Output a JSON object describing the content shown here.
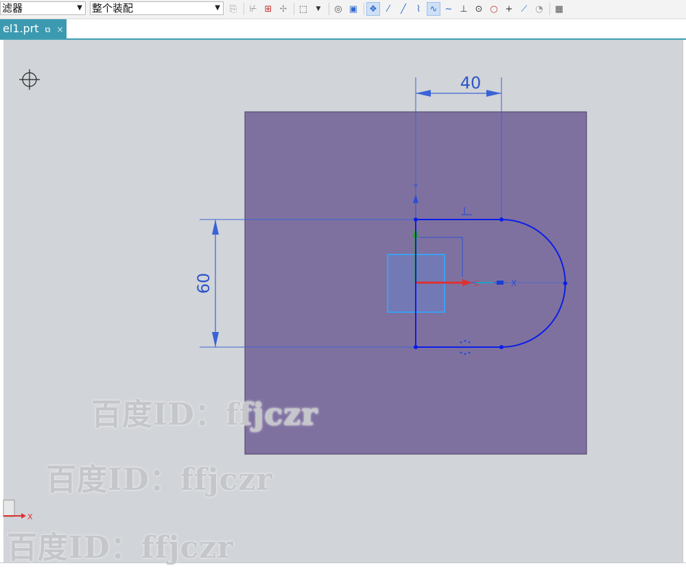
{
  "toolbar": {
    "filter_combo": {
      "value": "滤器"
    },
    "assembly_combo": {
      "value": "整个装配"
    },
    "icons": [
      "snap-icon",
      "sketch-icon",
      "insert-icon",
      "point-icon",
      "select-box-icon",
      "view-icon",
      "part-icon",
      "feature-icon",
      "line-icon",
      "line-tool-icon",
      "arc-icon",
      "spline-icon",
      "curve-icon",
      "perpendicular-icon",
      "circle-point-icon",
      "circle-icon",
      "crosshair-icon",
      "slash-icon",
      "shading-icon",
      "grid-icon"
    ]
  },
  "tab": {
    "label": "el1.prt",
    "pin_icon": "pin-icon",
    "close_glyph": "×"
  },
  "sketch": {
    "dimension_horizontal": "40",
    "dimension_vertical": "60",
    "y_axis_label": "Y",
    "x_axis_label": "X",
    "csys_x_label": "X",
    "cursor_icon": "crosshair-cursor-icon"
  },
  "watermarks": [
    "百度ID：ffjczr",
    "百度ID：ffjczr",
    "百度ID：ffjczr"
  ],
  "colors": {
    "plane": "#7f719f",
    "sketch_curve": "#0a1ee8",
    "dimension": "#3a63d6",
    "tab": "#3c9ab0",
    "viewport_bg": "#d1d4d8"
  }
}
